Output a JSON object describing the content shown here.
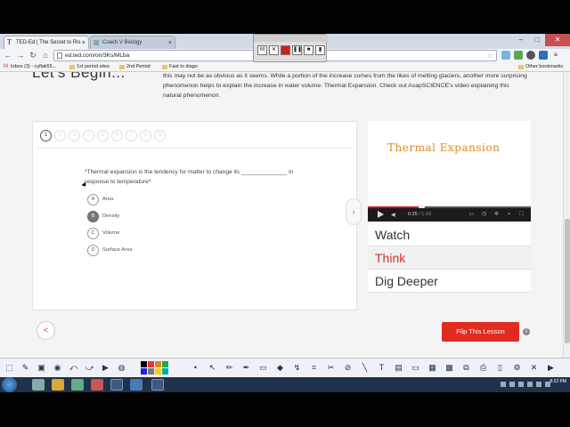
{
  "browser": {
    "tabs": [
      {
        "label": "TED-Ed | The Secret to Ris",
        "active": true
      },
      {
        "label": "Coach V Biology",
        "active": false
      }
    ],
    "url": "ed.ted.com/on/3Ks/MLba",
    "bookmarks": [
      {
        "label": "Inbox (3) - cyflak55...",
        "icon": "gmail-icon"
      },
      {
        "label": "1st period sites",
        "icon": "folder-icon"
      },
      {
        "label": "2nd Period",
        "icon": "folder-icon"
      },
      {
        "label": "Fast to diago",
        "icon": "folder-icon"
      },
      {
        "label": "Other bookmarks",
        "icon": "folder-icon"
      }
    ]
  },
  "lesson": {
    "heading": "Let's Begin...",
    "intro": "this may not be as obvious as it seems. While a portion of the increase comes from the likes of melting glaciers, another more surprising phenomenon helps to explain the increase in water volume: Thermal Expansion. Check out AsapSCIENCE's video explaining this natural phenomenon."
  },
  "quiz": {
    "question_numbers": [
      "1",
      "2",
      "3",
      "4",
      "5",
      "6",
      "7",
      "8",
      "9"
    ],
    "current_question": 1,
    "question": "*Thermal expansion is the tendency for matter to change its ______________ in response to temperature*",
    "options": [
      {
        "letter": "A",
        "text": "Area",
        "selected": false
      },
      {
        "letter": "B",
        "text": "Density",
        "selected": true
      },
      {
        "letter": "C",
        "text": "Volume",
        "selected": false
      },
      {
        "letter": "D",
        "text": "Surface Area",
        "selected": false
      }
    ],
    "next_arrow": "›"
  },
  "video": {
    "title_overlay": "Thermal Expansion",
    "current_time": "0:25",
    "total_time": "/ 1:15",
    "progress_fraction": 0.33
  },
  "side_menu": [
    {
      "label": "Watch",
      "active": false
    },
    {
      "label": "Think",
      "active": true
    },
    {
      "label": "Dig Deeper",
      "active": false
    }
  ],
  "footer": {
    "flip_button": "Flip This Lesson",
    "info": "i"
  },
  "colors": {
    "ted_red": "#e02b20",
    "title_orange": "#e08a1e"
  },
  "clock": {
    "time": "8:22 PM"
  }
}
